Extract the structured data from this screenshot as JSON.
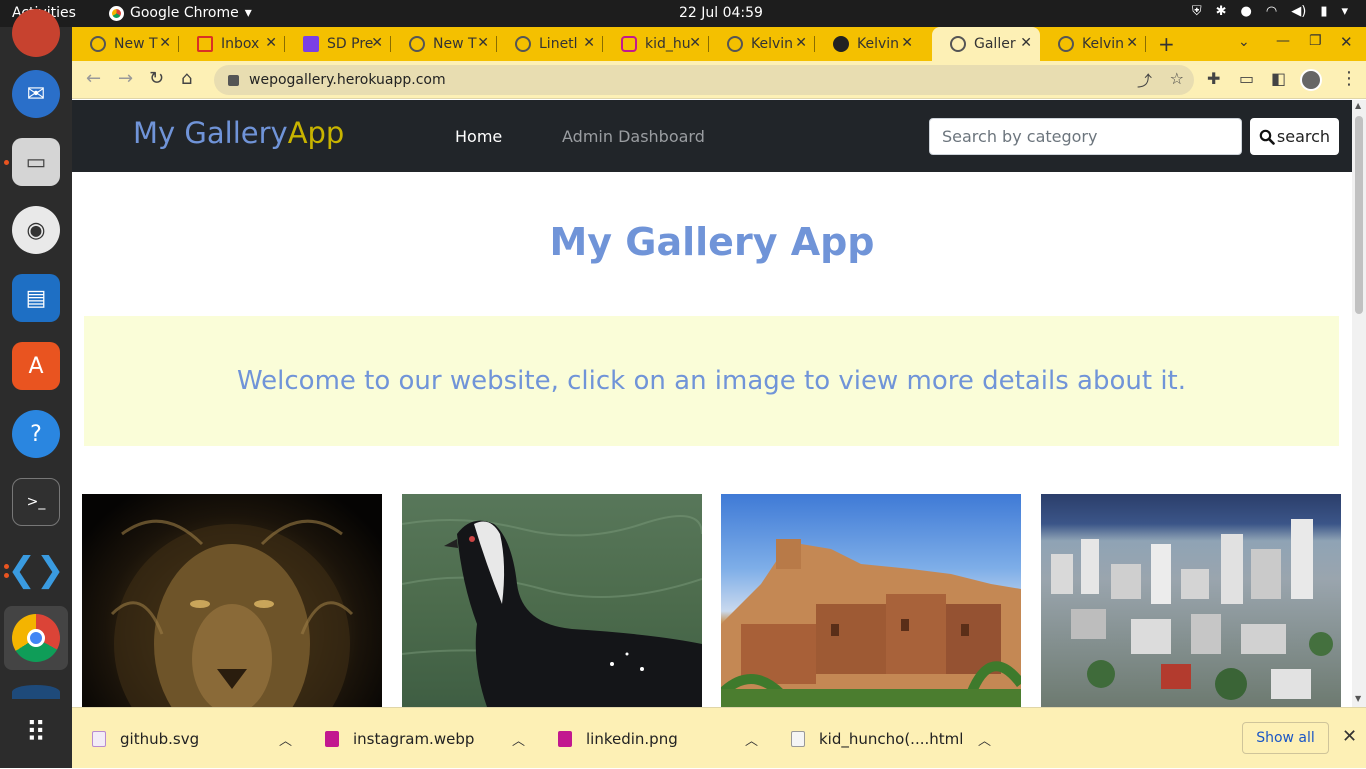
{
  "system": {
    "activities": "Activities",
    "app_name": "Google Chrome",
    "clock": "22 Jul  04:59"
  },
  "tabs": [
    {
      "label": "New T",
      "active": false
    },
    {
      "label": "Inbox",
      "active": false
    },
    {
      "label": "SD Pre",
      "active": false
    },
    {
      "label": "New T",
      "active": false
    },
    {
      "label": "Linetl",
      "active": false
    },
    {
      "label": "kid_hu",
      "active": false
    },
    {
      "label": "Kelvin",
      "active": false
    },
    {
      "label": "Kelvin",
      "active": false
    },
    {
      "label": "Galler",
      "active": true
    },
    {
      "label": "Kelvin",
      "active": false
    }
  ],
  "toolbar": {
    "url": "wepogallery.herokuapp.com"
  },
  "page": {
    "brand_part1": "My Gallery",
    "brand_part2": "App",
    "nav_home": "Home",
    "nav_admin": "Admin Dashboard",
    "search_placeholder": "Search by category",
    "search_button": "search",
    "heading": "My Gallery App",
    "welcome": "Welcome to our website, click on an image to view more details about it."
  },
  "gallery": [
    {
      "subject": "lion"
    },
    {
      "subject": "penguin"
    },
    {
      "subject": "desert-kasbah"
    },
    {
      "subject": "city-coast"
    }
  ],
  "downloads": {
    "items": [
      {
        "name": "github.svg",
        "icon_color": "#e8d8f0"
      },
      {
        "name": "instagram.webp",
        "icon_color": "#c2188f"
      },
      {
        "name": "linkedin.png",
        "icon_color": "#c2188f"
      },
      {
        "name": "kid_huncho(....html",
        "icon_color": "#e8e8e8"
      }
    ],
    "show_all": "Show all"
  },
  "colors": {
    "tab_strip": "#f4c000",
    "toolbar": "#fdf0b5",
    "navbar": "#212529",
    "brand_blue": "#7094d8",
    "brand_yellow": "#c8b400",
    "banner_bg": "#fafdd8"
  }
}
